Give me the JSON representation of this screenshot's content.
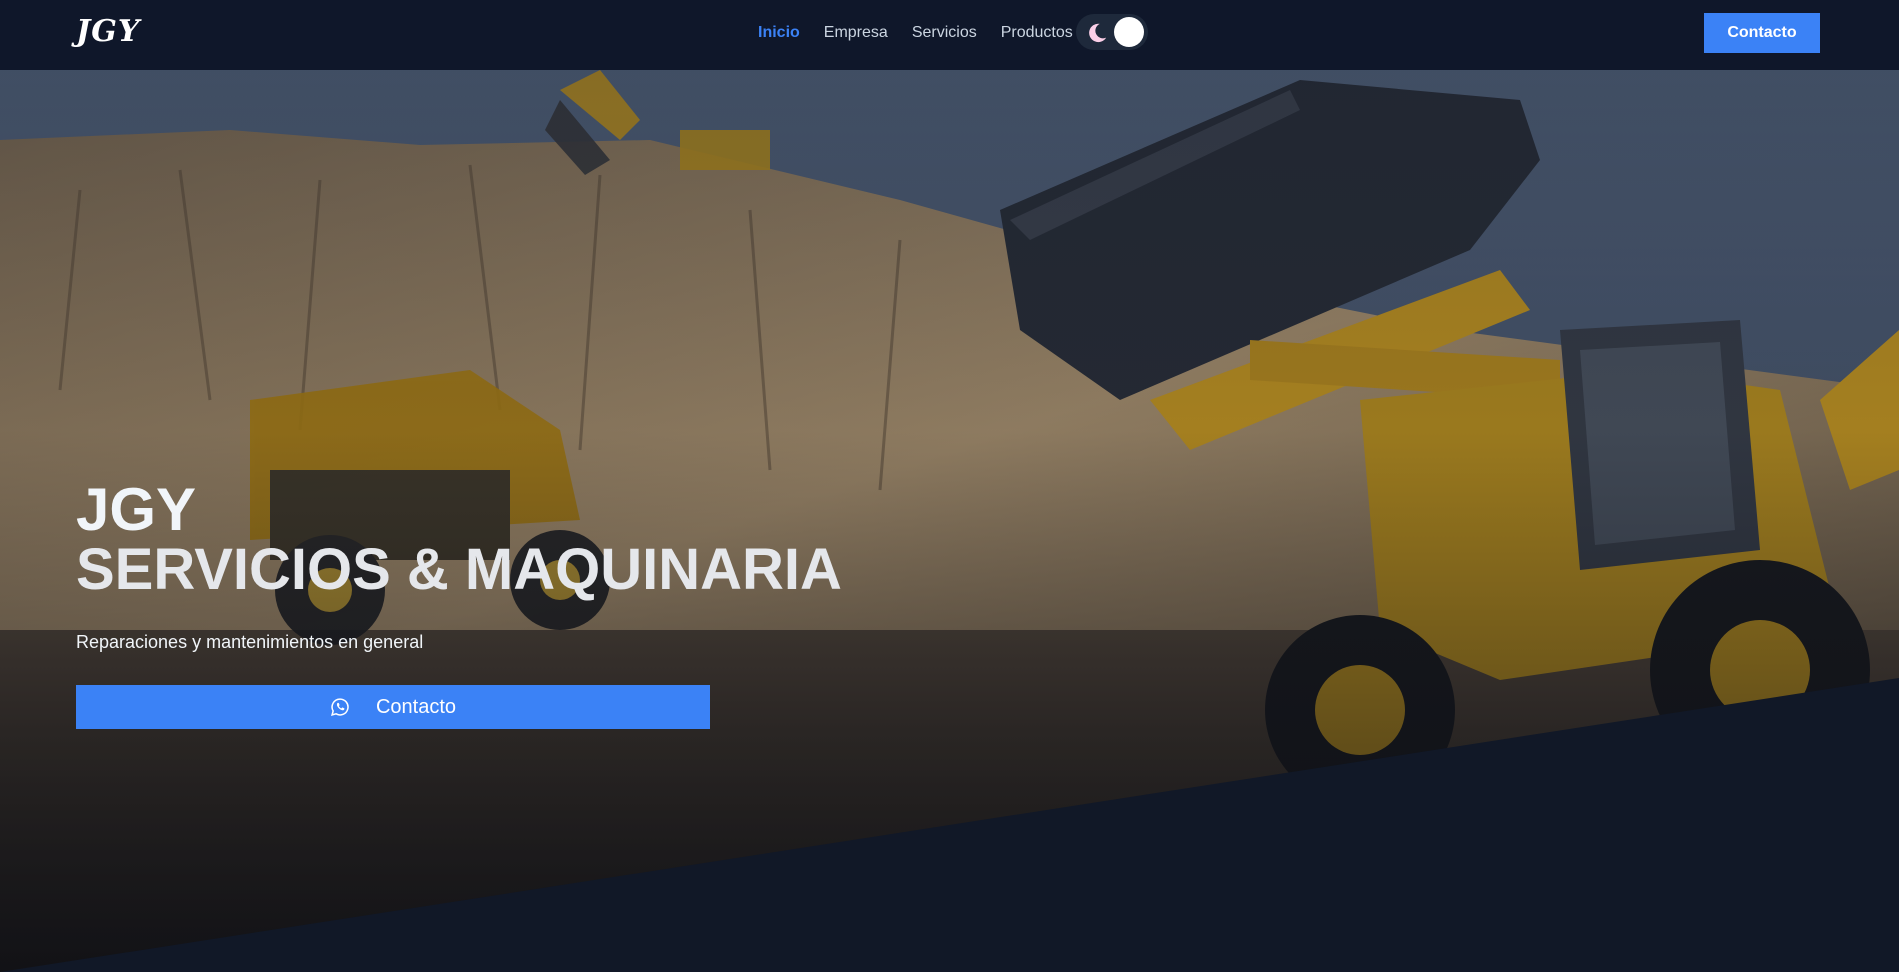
{
  "brand": {
    "logo_text": "JGY"
  },
  "nav": {
    "links": [
      {
        "label": "Inicio",
        "active": true
      },
      {
        "label": "Empresa",
        "active": false
      },
      {
        "label": "Servicios",
        "active": false
      },
      {
        "label": "Productos",
        "active": false
      }
    ],
    "theme_toggle": {
      "icon": "moon-icon",
      "mode": "dark"
    },
    "cta_label": "Contacto"
  },
  "hero": {
    "title_line1": "JGY",
    "title_line2": "SERVICIOS & MAQUINARIA",
    "subtitle": "Reparaciones y mantenimientos en general",
    "cta_label": "Contacto",
    "cta_icon": "whatsapp-icon",
    "background_image": "construction machinery at quarry"
  },
  "colors": {
    "navbar_bg": "#0f172a",
    "accent": "#3b82f6",
    "hero_dark": "#111827",
    "text_light": "#e5e7eb"
  }
}
